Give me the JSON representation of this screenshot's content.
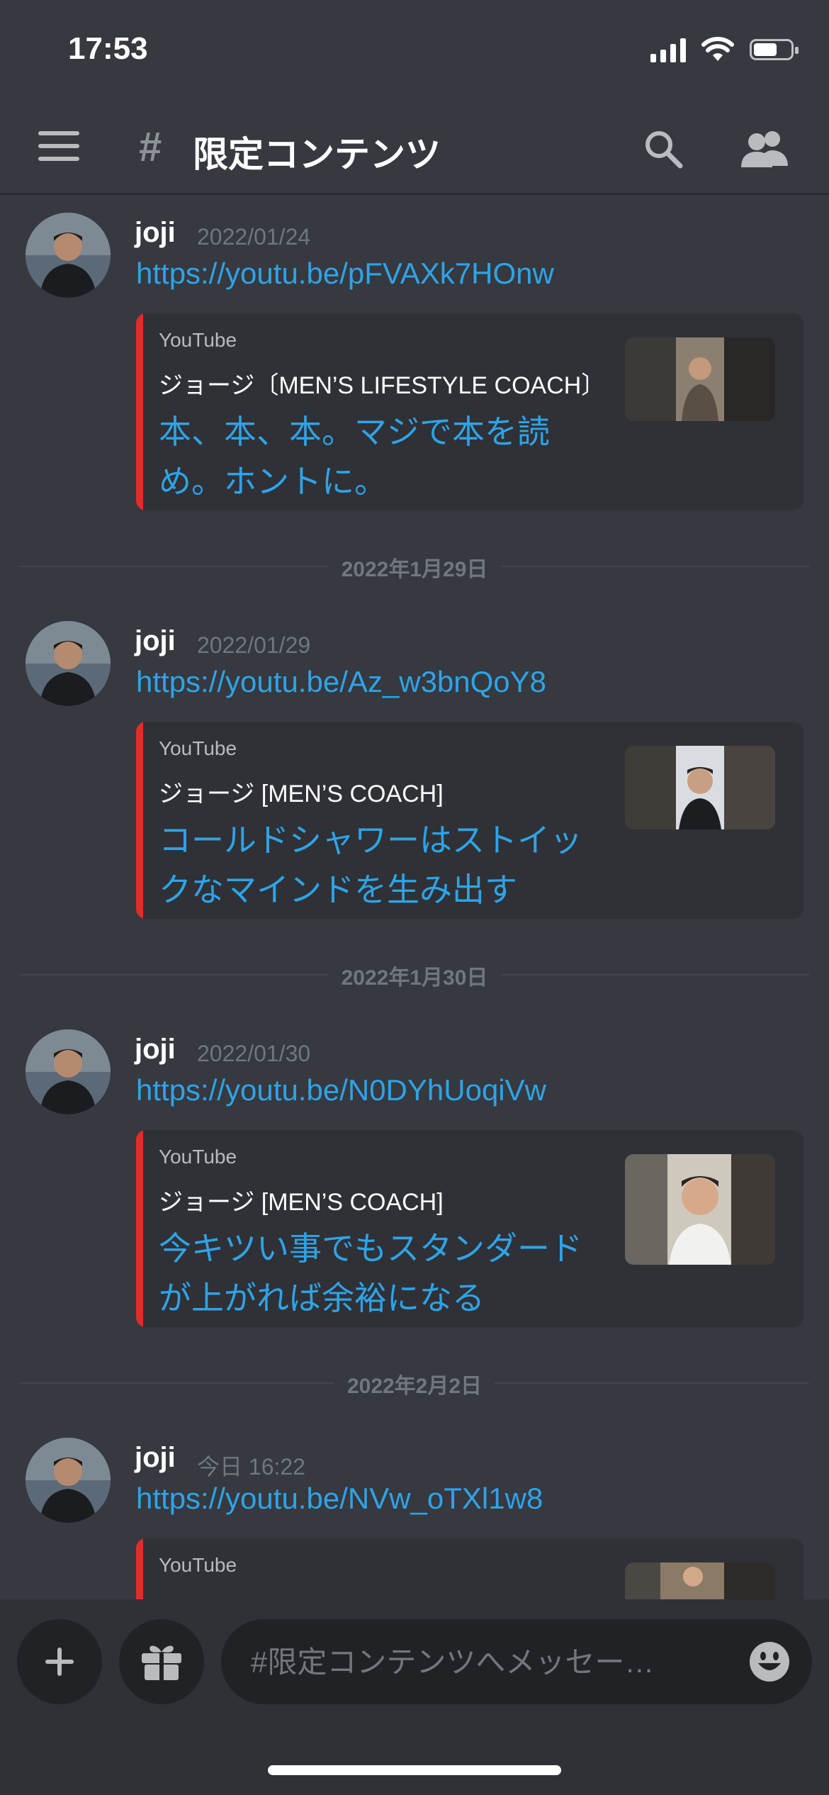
{
  "status_bar": {
    "time": "17:53"
  },
  "header": {
    "channel_name": "限定コンテンツ"
  },
  "messages": [
    {
      "username": "joji",
      "timestamp": "2022/01/24",
      "link": "https://youtu.be/pFVAXk7HOnw",
      "embed": {
        "provider": "YouTube",
        "author": "ジョージ〔MEN’S  LIFESTYLE COACH〕",
        "title": "本、本、本。マジで本を読め。ホントに。"
      }
    },
    {
      "username": "joji",
      "timestamp": "2022/01/29",
      "link": "https://youtu.be/Az_w3bnQoY8",
      "embed": {
        "provider": "YouTube",
        "author": "ジョージ [MEN’S COACH]",
        "title": "コールドシャワーはストイックなマインドを生み出す"
      }
    },
    {
      "username": "joji",
      "timestamp": "2022/01/30",
      "link": "https://youtu.be/N0DYhUoqiVw",
      "embed": {
        "provider": "YouTube",
        "author": "ジョージ [MEN’S COACH]",
        "title": "今キツい事でもスタンダードが上がれば余裕になる"
      }
    },
    {
      "username": "joji",
      "timestamp": "今日 16:22",
      "link": "https://youtu.be/NVw_oTXl1w8",
      "embed": {
        "provider": "YouTube",
        "author": "",
        "title": ""
      }
    }
  ],
  "dividers": [
    "2022年1月29日",
    "2022年1月30日",
    "2022年2月2日"
  ],
  "composer": {
    "placeholder": "#限定コンテンツへメッセー…"
  },
  "colors": {
    "background": "#36393f",
    "link": "#2fa3e6",
    "embed_bar": "#e52b28",
    "embed_bg": "#2f3136"
  },
  "icons": [
    "hamburger-icon",
    "hash-icon",
    "search-icon",
    "members-icon",
    "plus-icon",
    "gift-icon",
    "emoji-icon"
  ]
}
